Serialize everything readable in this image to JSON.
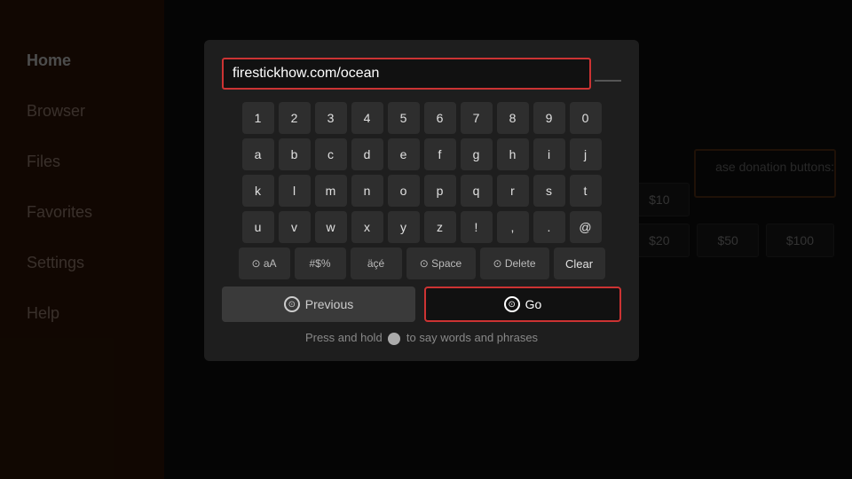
{
  "sidebar": {
    "items": [
      {
        "label": "Home",
        "active": true
      },
      {
        "label": "Browser",
        "active": false
      },
      {
        "label": "Files",
        "active": false
      },
      {
        "label": "Favorites",
        "active": false
      },
      {
        "label": "Settings",
        "active": false
      },
      {
        "label": "Help",
        "active": false
      }
    ]
  },
  "dialog": {
    "url_value": "firestickhow.com/ocean",
    "keyboard": {
      "row1": [
        "1",
        "2",
        "3",
        "4",
        "5",
        "6",
        "7",
        "8",
        "9",
        "0"
      ],
      "row2": [
        "a",
        "b",
        "c",
        "d",
        "e",
        "f",
        "g",
        "h",
        "i",
        "j"
      ],
      "row3": [
        "k",
        "l",
        "m",
        "n",
        "o",
        "p",
        "q",
        "r",
        "s",
        "t"
      ],
      "row4": [
        "u",
        "v",
        "w",
        "x",
        "y",
        "z",
        "!",
        ",",
        ".",
        "@"
      ],
      "row5_special": [
        "aA",
        "#$%",
        "äçé",
        "Space",
        "Delete",
        "Clear"
      ]
    },
    "previous_label": "Previous",
    "go_label": "Go",
    "voice_hint": "Press and hold   to say words and phrases"
  },
  "donation": {
    "label": "ase donation buttons:",
    "amounts": [
      "$10",
      "$20",
      "$50",
      "$100"
    ]
  },
  "icons": {
    "circle_icon": "⊙",
    "mic_icon": "🎙"
  }
}
